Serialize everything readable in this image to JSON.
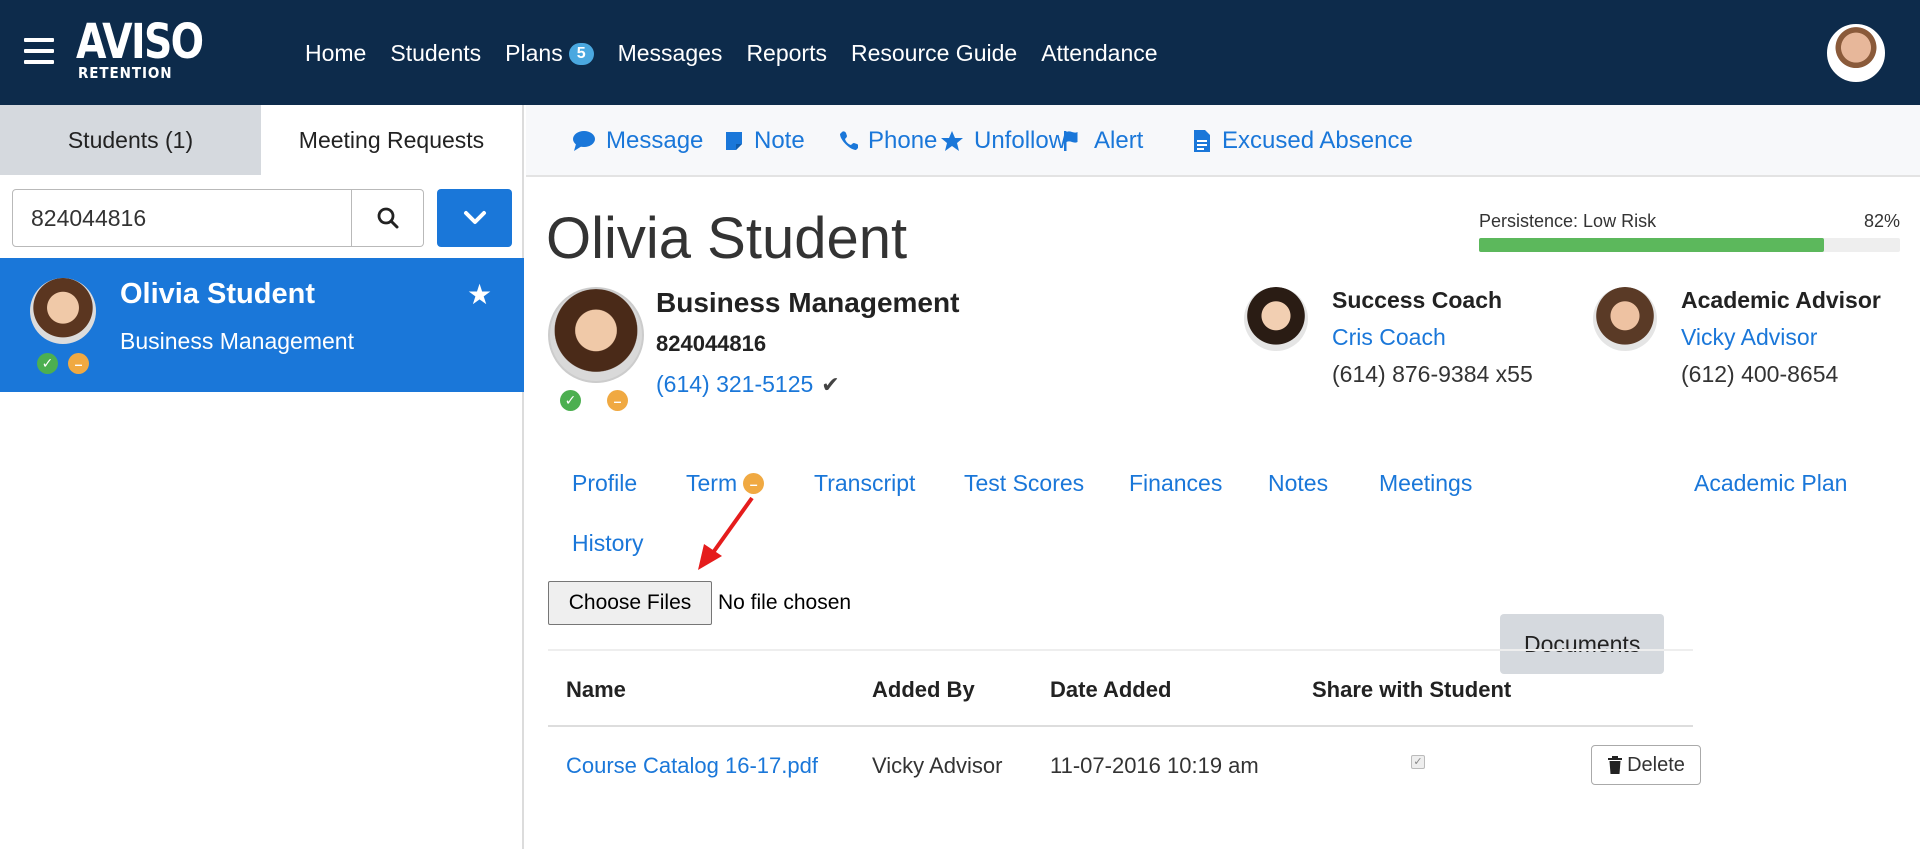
{
  "app": {
    "logo_top": "AVISO",
    "logo_bottom": "RETENTION"
  },
  "nav": {
    "items": [
      "Home",
      "Students",
      "Plans",
      "Messages",
      "Reports",
      "Resource Guide",
      "Attendance"
    ],
    "plans_badge": "5"
  },
  "left": {
    "tab_students": "Students (1)",
    "tab_meetings": "Meeting Requests",
    "search_value": "824044816",
    "card": {
      "name": "Olivia Student",
      "major": "Business Management"
    }
  },
  "actions": {
    "message": "Message",
    "note": "Note",
    "phone": "Phone",
    "unfollow": "Unfollow",
    "alert": "Alert",
    "excused": "Excused Absence"
  },
  "student": {
    "name": "Olivia Student",
    "major": "Business Management",
    "id": "824044816",
    "phone": "(614) 321-5125"
  },
  "persistence": {
    "label": "Persistence: Low Risk",
    "percent_label": "82%",
    "percent": 82
  },
  "contacts": {
    "coach": {
      "role": "Success Coach",
      "name": "Cris Coach",
      "phone": "(614) 876-9384 x55"
    },
    "advisor": {
      "role": "Academic Advisor",
      "name": "Vicky Advisor",
      "phone": "(612) 400-8654"
    }
  },
  "tabs": [
    "Profile",
    "Term",
    "Transcript",
    "Test Scores",
    "Finances",
    "Notes",
    "Meetings",
    "Documents",
    "Academic Plan",
    "History"
  ],
  "active_tab": "Documents",
  "upload": {
    "button": "Choose Files",
    "status": "No file chosen"
  },
  "documents": {
    "columns": [
      "Name",
      "Added By",
      "Date Added",
      "Share with Student"
    ],
    "rows": [
      {
        "name": "Course Catalog 16-17.pdf",
        "added_by": "Vicky Advisor",
        "date": "11-07-2016 10:19 am",
        "shared": true
      }
    ],
    "delete_label": "Delete"
  },
  "colors": {
    "topbar": "#0d2b4b",
    "accent": "#1a77d9",
    "progress": "#5cb85c",
    "risk_ok": "#4caf50",
    "risk_warn": "#f0a942"
  }
}
